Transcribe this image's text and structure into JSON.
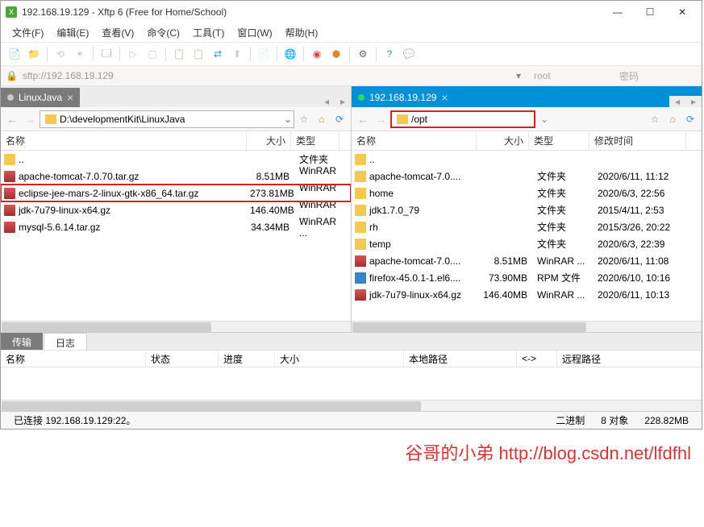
{
  "title": "192.168.19.129 - Xftp 6 (Free for Home/School)",
  "menu": [
    "文件(F)",
    "编辑(E)",
    "查看(V)",
    "命令(C)",
    "工具(T)",
    "窗口(W)",
    "帮助(H)"
  ],
  "addrbar": {
    "url": "sftp://192.168.19.129",
    "user": "root",
    "pass": "密码"
  },
  "left": {
    "tab": "LinuxJava",
    "path": "D:\\developmentKit\\LinuxJava",
    "cols": {
      "name": "名称",
      "size": "大小",
      "type": "类型"
    },
    "cw": {
      "name": 305,
      "size": 55,
      "type": 60
    },
    "rows": [
      {
        "ic": "folder",
        "name": "..",
        "size": "",
        "type": "文件夹"
      },
      {
        "ic": "arc",
        "name": "apache-tomcat-7.0.70.tar.gz",
        "size": "8.51MB",
        "type": "WinRAR ..."
      },
      {
        "ic": "arc",
        "name": "eclipse-jee-mars-2-linux-gtk-x86_64.tar.gz",
        "size": "273.81MB",
        "type": "WinRAR ...",
        "sel": true
      },
      {
        "ic": "arc",
        "name": "jdk-7u79-linux-x64.gz",
        "size": "146.40MB",
        "type": "WinRAR ..."
      },
      {
        "ic": "arc",
        "name": "mysql-5.6.14.tar.gz",
        "size": "34.34MB",
        "type": "WinRAR ..."
      }
    ]
  },
  "right": {
    "tab": "192.168.19.129",
    "path": "/opt",
    "cols": {
      "name": "名称",
      "size": "大小",
      "type": "类型",
      "mod": "修改时间"
    },
    "cw": {
      "name": 155,
      "size": 65,
      "type": 75,
      "mod": 120
    },
    "rows": [
      {
        "ic": "folder",
        "name": "..",
        "size": "",
        "type": "",
        "mod": ""
      },
      {
        "ic": "folder",
        "name": "apache-tomcat-7.0....",
        "size": "",
        "type": "文件夹",
        "mod": "2020/6/11, 11:12"
      },
      {
        "ic": "folder",
        "name": "home",
        "size": "",
        "type": "文件夹",
        "mod": "2020/6/3, 22:56"
      },
      {
        "ic": "folder",
        "name": "jdk1.7.0_79",
        "size": "",
        "type": "文件夹",
        "mod": "2015/4/11, 2:53"
      },
      {
        "ic": "folder",
        "name": "rh",
        "size": "",
        "type": "文件夹",
        "mod": "2015/3/26, 20:22"
      },
      {
        "ic": "folder",
        "name": "temp",
        "size": "",
        "type": "文件夹",
        "mod": "2020/6/3, 22:39"
      },
      {
        "ic": "arc",
        "name": "apache-tomcat-7.0....",
        "size": "8.51MB",
        "type": "WinRAR ...",
        "mod": "2020/6/11, 11:08"
      },
      {
        "ic": "rpm",
        "name": "firefox-45.0.1-1.el6....",
        "size": "73.90MB",
        "type": "RPM 文件",
        "mod": "2020/6/10, 10:16"
      },
      {
        "ic": "arc",
        "name": "jdk-7u79-linux-x64.gz",
        "size": "146.40MB",
        "type": "WinRAR ...",
        "mod": "2020/6/11, 10:13"
      }
    ]
  },
  "bottabs": [
    "传输",
    "日志"
  ],
  "xfercols": {
    "name": "名称",
    "status": "状态",
    "progress": "进度",
    "size": "大小",
    "local": "本地路径",
    "arrow": "<->",
    "remote": "远程路径"
  },
  "status": {
    "conn": "已连接 192.168.19.129:22。",
    "mode": "二进制",
    "obj": "8 对象",
    "total": "228.82MB"
  },
  "watermark": "谷哥的小弟 http://blog.csdn.net/lfdfhl"
}
